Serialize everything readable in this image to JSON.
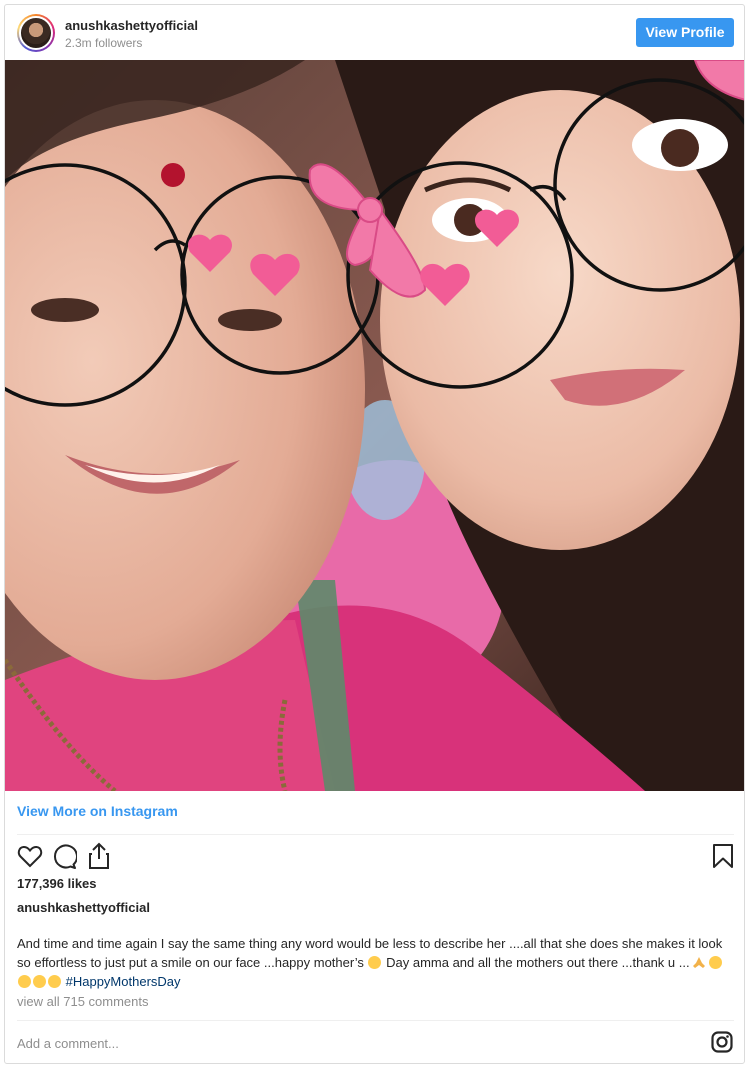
{
  "header": {
    "username": "anushkashettyofficial",
    "followers": "2.3m followers",
    "view_profile_label": "View Profile"
  },
  "post": {
    "view_more_label": "View More on Instagram",
    "likes": "177,396 likes",
    "caption_user": "anushkashettyofficial",
    "caption_part1": "And time and time again I say the same thing any word would be less to describe her ....all that she does she makes it look so effortless to just put a smile on our face ...happy mother’s",
    "caption_part2": "Day amma and all the mothers out there ...thank u ...",
    "hashtag": "#HappyMothersDay",
    "view_comments": "view all 715 comments",
    "add_comment_placeholder": "Add a comment..."
  },
  "icons": [
    "heart-icon",
    "comment-icon",
    "share-icon",
    "bookmark-icon",
    "instagram-icon"
  ],
  "colors": {
    "accent": "#3897f0",
    "hashtag": "#00376b",
    "muted": "#8e8e8e",
    "text": "#262626",
    "border": "#dbdbdb"
  }
}
